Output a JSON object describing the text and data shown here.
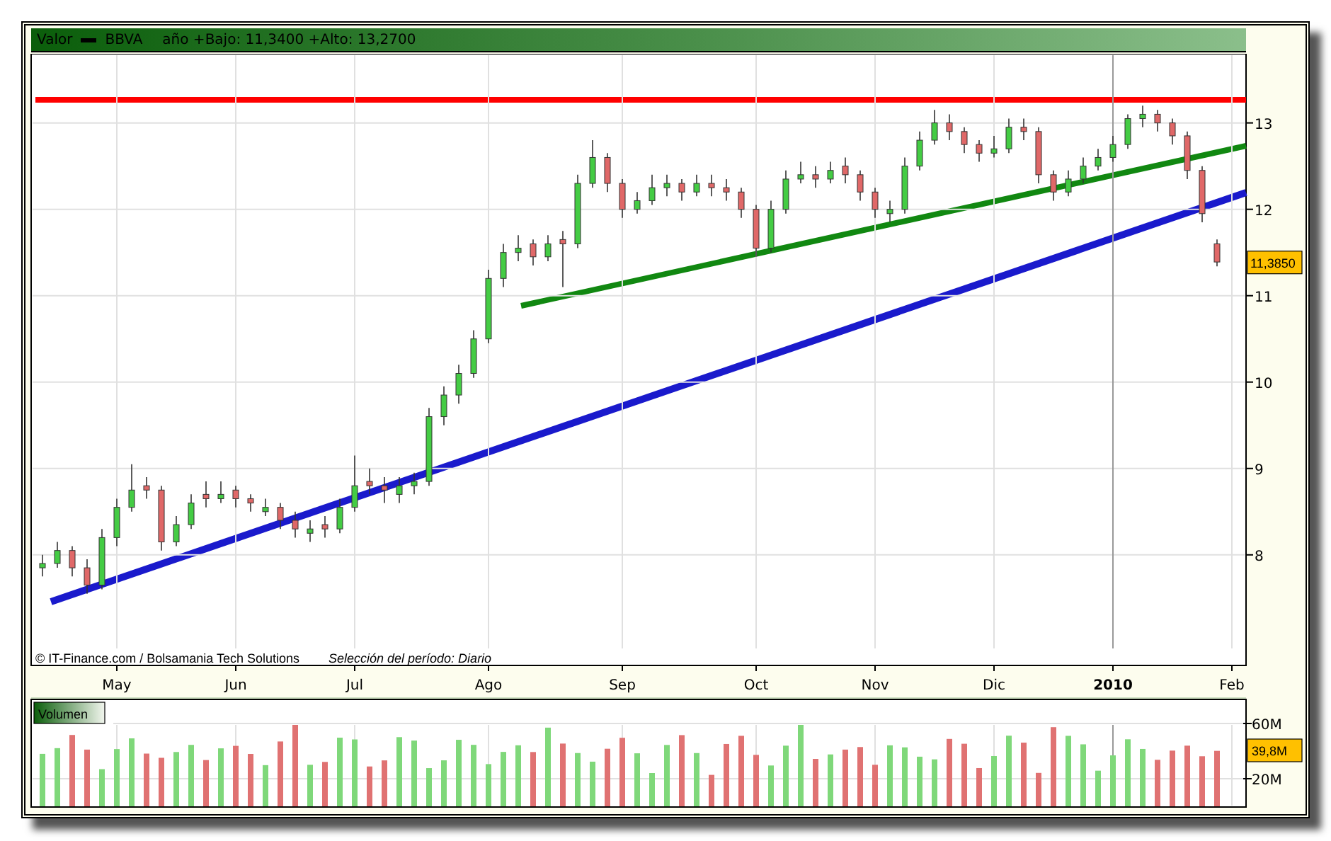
{
  "header": {
    "label": "Valor",
    "symbol": "BBVA",
    "range_text": "año +Bajo: 11,3400 +Alto: 13,2700"
  },
  "price_chart": {
    "chart_data": {
      "type": "candlestick",
      "ylim": [
        6.72,
        13.8
      ],
      "yticks": [
        13,
        12,
        11,
        10,
        9,
        8
      ],
      "grid": true,
      "categories": [
        null,
        null,
        null,
        null,
        null,
        "May",
        null,
        null,
        null,
        null,
        null,
        null,
        null,
        "Jun",
        null,
        null,
        null,
        null,
        null,
        null,
        null,
        "Jul",
        null,
        null,
        null,
        null,
        null,
        null,
        null,
        null,
        "Ago",
        null,
        null,
        null,
        null,
        null,
        null,
        null,
        null,
        "Sep",
        null,
        null,
        null,
        null,
        null,
        null,
        null,
        null,
        "Oct",
        null,
        null,
        null,
        null,
        null,
        null,
        null,
        "Nov",
        null,
        null,
        null,
        null,
        null,
        null,
        null,
        "Dic",
        null,
        null,
        null,
        null,
        null,
        null,
        null,
        "2010",
        null,
        null,
        null,
        null,
        null,
        null,
        null,
        "Feb"
      ],
      "ohlc": [
        [
          7.85,
          8.0,
          7.75,
          7.9
        ],
        [
          7.9,
          8.15,
          7.85,
          8.05
        ],
        [
          8.05,
          8.1,
          7.75,
          7.85
        ],
        [
          7.85,
          7.95,
          7.55,
          7.65
        ],
        [
          7.65,
          8.3,
          7.6,
          8.2
        ],
        [
          8.2,
          8.65,
          8.1,
          8.55
        ],
        [
          8.55,
          9.05,
          8.5,
          8.75
        ],
        [
          8.8,
          8.9,
          8.65,
          8.75
        ],
        [
          8.75,
          8.8,
          8.05,
          8.15
        ],
        [
          8.15,
          8.45,
          8.1,
          8.35
        ],
        [
          8.35,
          8.7,
          8.3,
          8.6
        ],
        [
          8.7,
          8.85,
          8.55,
          8.65
        ],
        [
          8.65,
          8.85,
          8.6,
          8.7
        ],
        [
          8.75,
          8.8,
          8.55,
          8.65
        ],
        [
          8.65,
          8.7,
          8.5,
          8.6
        ],
        [
          8.5,
          8.65,
          8.45,
          8.55
        ],
        [
          8.55,
          8.6,
          8.3,
          8.4
        ],
        [
          8.4,
          8.5,
          8.2,
          8.3
        ],
        [
          8.25,
          8.4,
          8.15,
          8.3
        ],
        [
          8.35,
          8.45,
          8.2,
          8.3
        ],
        [
          8.3,
          8.65,
          8.25,
          8.55
        ],
        [
          8.55,
          9.15,
          8.5,
          8.8
        ],
        [
          8.85,
          9.0,
          8.7,
          8.8
        ],
        [
          8.8,
          8.9,
          8.6,
          8.75
        ],
        [
          8.7,
          8.9,
          8.6,
          8.8
        ],
        [
          8.8,
          8.95,
          8.7,
          8.85
        ],
        [
          8.85,
          9.7,
          8.8,
          9.6
        ],
        [
          9.6,
          9.95,
          9.5,
          9.85
        ],
        [
          9.85,
          10.2,
          9.75,
          10.1
        ],
        [
          10.1,
          10.6,
          10.05,
          10.5
        ],
        [
          10.5,
          11.3,
          10.45,
          11.2
        ],
        [
          11.2,
          11.6,
          11.1,
          11.5
        ],
        [
          11.5,
          11.7,
          11.4,
          11.55
        ],
        [
          11.6,
          11.65,
          11.35,
          11.45
        ],
        [
          11.45,
          11.7,
          11.4,
          11.6
        ],
        [
          11.65,
          11.75,
          11.1,
          11.6
        ],
        [
          11.6,
          12.4,
          11.55,
          12.3
        ],
        [
          12.3,
          12.8,
          12.25,
          12.6
        ],
        [
          12.6,
          12.65,
          12.2,
          12.3
        ],
        [
          12.3,
          12.35,
          11.9,
          12.0
        ],
        [
          12.0,
          12.2,
          11.95,
          12.1
        ],
        [
          12.1,
          12.4,
          12.05,
          12.25
        ],
        [
          12.25,
          12.4,
          12.15,
          12.3
        ],
        [
          12.3,
          12.35,
          12.1,
          12.2
        ],
        [
          12.2,
          12.4,
          12.15,
          12.3
        ],
        [
          12.3,
          12.4,
          12.15,
          12.25
        ],
        [
          12.25,
          12.35,
          12.1,
          12.2
        ],
        [
          12.2,
          12.25,
          11.9,
          12.0
        ],
        [
          12.0,
          12.05,
          11.45,
          11.55
        ],
        [
          11.55,
          12.1,
          11.5,
          12.0
        ],
        [
          12.0,
          12.45,
          11.95,
          12.35
        ],
        [
          12.35,
          12.55,
          12.3,
          12.4
        ],
        [
          12.4,
          12.5,
          12.25,
          12.35
        ],
        [
          12.35,
          12.55,
          12.3,
          12.45
        ],
        [
          12.5,
          12.6,
          12.3,
          12.4
        ],
        [
          12.4,
          12.45,
          12.1,
          12.2
        ],
        [
          12.2,
          12.25,
          11.9,
          12.0
        ],
        [
          11.95,
          12.1,
          11.85,
          12.0
        ],
        [
          12.0,
          12.6,
          11.95,
          12.5
        ],
        [
          12.5,
          12.9,
          12.45,
          12.8
        ],
        [
          12.8,
          13.15,
          12.75,
          13.0
        ],
        [
          13.0,
          13.1,
          12.8,
          12.9
        ],
        [
          12.9,
          12.95,
          12.65,
          12.75
        ],
        [
          12.75,
          12.8,
          12.55,
          12.65
        ],
        [
          12.65,
          12.85,
          12.6,
          12.7
        ],
        [
          12.7,
          13.05,
          12.65,
          12.95
        ],
        [
          12.95,
          13.05,
          12.8,
          12.9
        ],
        [
          12.9,
          12.95,
          12.3,
          12.4
        ],
        [
          12.4,
          12.45,
          12.1,
          12.2
        ],
        [
          12.2,
          12.45,
          12.15,
          12.35
        ],
        [
          12.35,
          12.6,
          12.3,
          12.5
        ],
        [
          12.5,
          12.7,
          12.45,
          12.6
        ],
        [
          12.6,
          12.85,
          12.55,
          12.75
        ],
        [
          12.75,
          13.1,
          12.7,
          13.05
        ],
        [
          13.05,
          13.2,
          12.95,
          13.1
        ],
        [
          13.1,
          13.15,
          12.9,
          13.0
        ],
        [
          13.0,
          13.05,
          12.75,
          12.85
        ],
        [
          12.85,
          12.9,
          12.35,
          12.45
        ],
        [
          12.45,
          12.5,
          11.85,
          11.95
        ],
        [
          11.6,
          11.65,
          11.34,
          11.39
        ],
        null
      ]
    },
    "x_label_styles": [
      {
        "bold": false
      },
      {
        "bold": false
      },
      {
        "bold": false
      },
      {
        "bold": false
      },
      {
        "bold": false
      },
      {
        "bold": false
      },
      {
        "bold": false
      },
      {
        "bold": false
      },
      {
        "bold": true
      },
      {
        "bold": false
      }
    ],
    "last_price": "11,3850"
  },
  "credits": "© IT-Finance.com / Bolsamania Tech Solutions",
  "period": "Selección del período: Diario",
  "volume": {
    "title": "Volumen",
    "ticks": [
      "60M",
      "20M"
    ],
    "last_volume": "39,8M"
  }
}
